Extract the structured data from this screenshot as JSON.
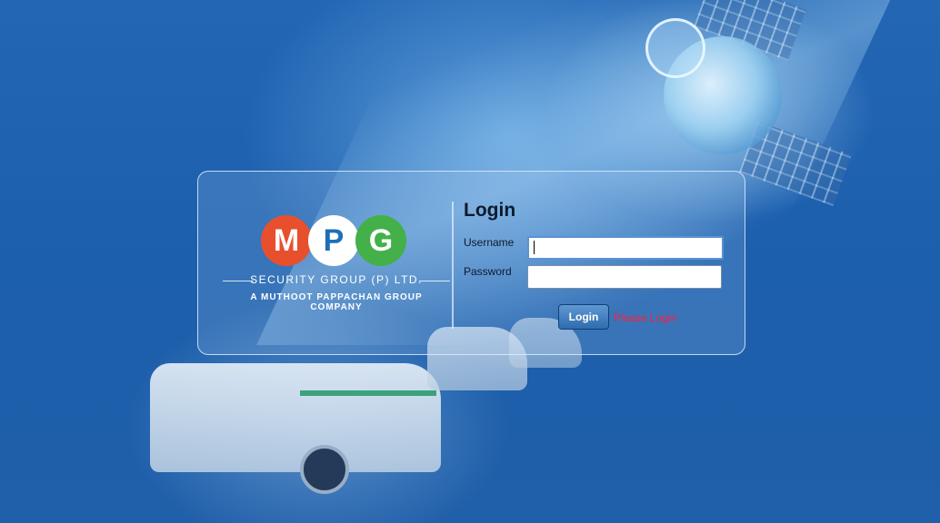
{
  "logo": {
    "letters": [
      "M",
      "P",
      "G"
    ],
    "line1": "SECURITY GROUP (P) LTD.",
    "line2": "A MUTHOOT PAPPACHAN GROUP COMPANY",
    "colors": {
      "m": "#e8502d",
      "p": "#ffffff",
      "g": "#43b049"
    }
  },
  "login": {
    "title": "Login",
    "username_label": "Username",
    "password_label": "Password",
    "username_value": "",
    "password_value": "",
    "button_label": "Login",
    "status_message": "Please Login"
  },
  "colors": {
    "background": "#1f63ad",
    "status": "#ff1d3a"
  },
  "icons": [
    "satellite-illustration",
    "taxi-illustration"
  ]
}
